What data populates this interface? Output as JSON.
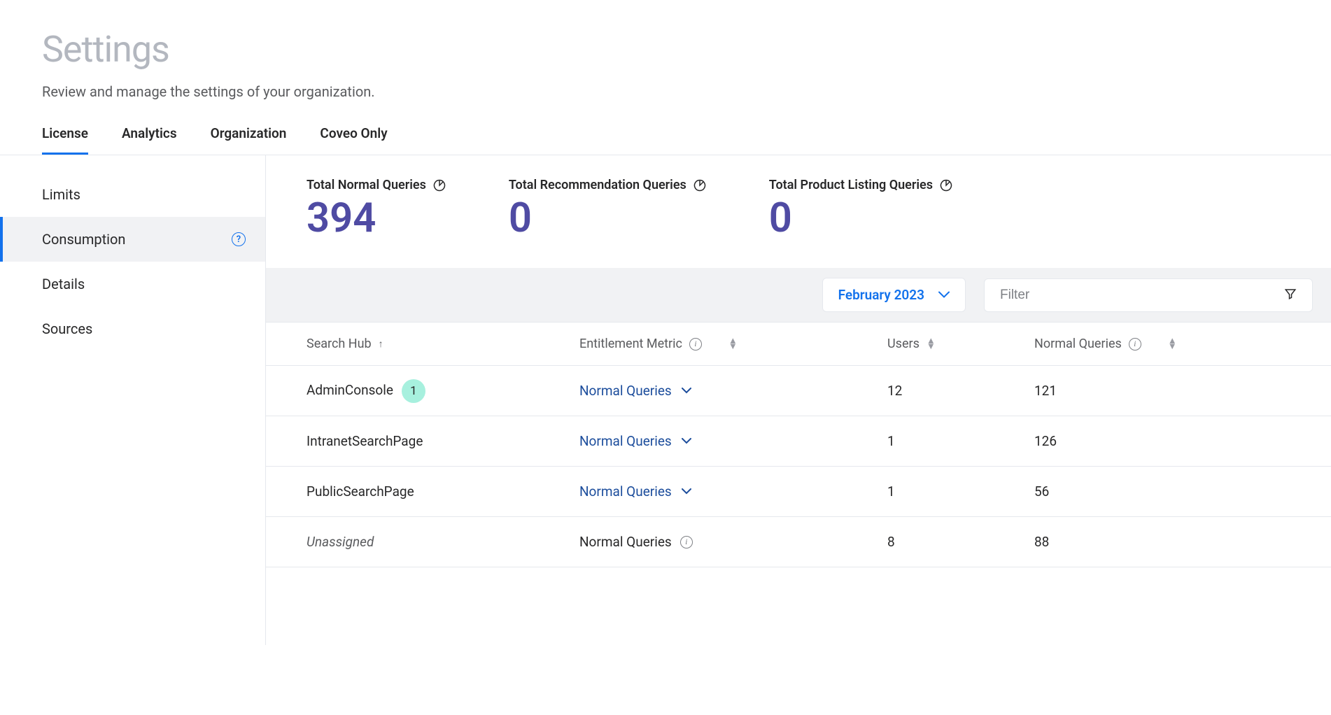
{
  "header": {
    "title": "Settings",
    "subtitle": "Review and manage the settings of your organization."
  },
  "tabs": [
    {
      "label": "License",
      "active": true
    },
    {
      "label": "Analytics",
      "active": false
    },
    {
      "label": "Organization",
      "active": false
    },
    {
      "label": "Coveo Only",
      "active": false
    }
  ],
  "sidebar": {
    "items": [
      {
        "label": "Limits",
        "active": false,
        "has_help": false
      },
      {
        "label": "Consumption",
        "active": true,
        "has_help": true
      },
      {
        "label": "Details",
        "active": false,
        "has_help": false
      },
      {
        "label": "Sources",
        "active": false,
        "has_help": false
      }
    ]
  },
  "stats": [
    {
      "label": "Total Normal Queries",
      "value": "394"
    },
    {
      "label": "Total Recommendation Queries",
      "value": "0"
    },
    {
      "label": "Total Product Listing Queries",
      "value": "0"
    }
  ],
  "toolbar": {
    "month_label": "February 2023",
    "filter_placeholder": "Filter"
  },
  "table": {
    "columns": {
      "search_hub": "Search Hub",
      "metric": "Entitlement Metric",
      "users": "Users",
      "queries": "Normal Queries"
    },
    "rows": [
      {
        "search_hub": "AdminConsole",
        "badge": "1",
        "metric": "Normal Queries",
        "metric_link": true,
        "users": "12",
        "queries": "121",
        "italic": false
      },
      {
        "search_hub": "IntranetSearchPage",
        "badge": null,
        "metric": "Normal Queries",
        "metric_link": true,
        "users": "1",
        "queries": "126",
        "italic": false
      },
      {
        "search_hub": "PublicSearchPage",
        "badge": null,
        "metric": "Normal Queries",
        "metric_link": true,
        "users": "1",
        "queries": "56",
        "italic": false
      },
      {
        "search_hub": "Unassigned",
        "badge": null,
        "metric": "Normal Queries",
        "metric_link": false,
        "users": "8",
        "queries": "88",
        "italic": true
      }
    ]
  }
}
